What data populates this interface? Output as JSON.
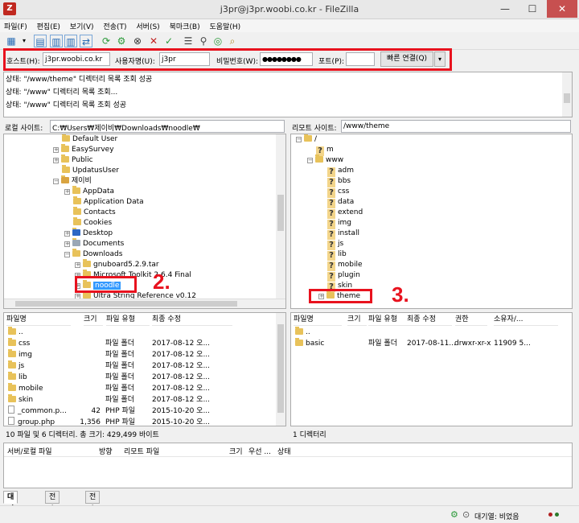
{
  "window": {
    "title": "j3pr@j3pr.woobi.co.kr - FileZilla",
    "app_icon": "Z",
    "minimize": "—",
    "maximize": "☐",
    "close": "✕"
  },
  "menu": [
    "파일(F)",
    "편집(E)",
    "보기(V)",
    "전송(T)",
    "서버(S)",
    "북마크(B)",
    "도움말(H)"
  ],
  "quickconnect": {
    "host_label": "호스트(H):",
    "host_value": "j3pr.woobi.co.kr",
    "user_label": "사용자명(U):",
    "user_value": "j3pr",
    "pass_label": "비밀번호(W):",
    "pass_value": "●●●●●●●●",
    "port_label": "포트(P):",
    "port_value": "",
    "connect_button": "빠른 연결(Q)",
    "dropdown": "▾"
  },
  "annotations": {
    "one": "1.",
    "two": "2.",
    "three": "3."
  },
  "log": [
    "상태:  \"/www/theme\" 디렉터리 목록 조회 성공",
    "상태:  \"/www\" 디렉터리 목록 조회...",
    "상태:  \"/www\" 디렉터리 목록 조회 성공"
  ],
  "local": {
    "label": "로컬 사이트:",
    "path": "C:₩Users₩제이비₩Downloads₩noodle₩",
    "tree": {
      "default_user": "Default User",
      "easysurvey": "EasySurvey",
      "public": "Public",
      "updatususer": "UpdatusUser",
      "jeibi": "제이비",
      "appdata": "AppData",
      "application_data": "Application Data",
      "contacts": "Contacts",
      "cookies": "Cookies",
      "desktop": "Desktop",
      "documents": "Documents",
      "downloads": "Downloads",
      "gnuboard": "gnuboard5.2.9.tar",
      "mstoolkit": "Microsoft Toolkit 2.6.4 Final",
      "noodle": "noodle",
      "ultrastring": "Ultra String Reference v0.12"
    },
    "columns": [
      "파일명",
      "크기",
      "파일 유형",
      "최종 수정"
    ],
    "files": [
      {
        "name": "..",
        "size": "",
        "type": "",
        "modified": ""
      },
      {
        "name": "css",
        "size": "",
        "type": "파일 폴더",
        "modified": "2017-08-12 오..."
      },
      {
        "name": "img",
        "size": "",
        "type": "파일 폴더",
        "modified": "2017-08-12 오..."
      },
      {
        "name": "js",
        "size": "",
        "type": "파일 폴더",
        "modified": "2017-08-12 오..."
      },
      {
        "name": "lib",
        "size": "",
        "type": "파일 폴더",
        "modified": "2017-08-12 오..."
      },
      {
        "name": "mobile",
        "size": "",
        "type": "파일 폴더",
        "modified": "2017-08-12 오..."
      },
      {
        "name": "skin",
        "size": "",
        "type": "파일 폴더",
        "modified": "2017-08-12 오..."
      },
      {
        "name": "_common.p...",
        "size": "42",
        "type": "PHP 파일",
        "modified": "2015-10-20 오..."
      },
      {
        "name": "group.php",
        "size": "1,356",
        "type": "PHP 파일",
        "modified": "2015-10-20 오..."
      }
    ],
    "status": "10 파일 및 6 디렉터리. 총 크기: 429,499 바이트"
  },
  "remote": {
    "label": "리모트 사이트:",
    "path": "/www/theme",
    "tree": {
      "root": "/",
      "m": "m",
      "www": "www",
      "adm": "adm",
      "bbs": "bbs",
      "css": "css",
      "data": "data",
      "extend": "extend",
      "img": "img",
      "install": "install",
      "js": "js",
      "lib": "lib",
      "mobile": "mobile",
      "plugin": "plugin",
      "skin": "skin",
      "theme": "theme"
    },
    "columns": [
      "파일명",
      "크기",
      "파일 유형",
      "최종 수정",
      "권한",
      "소유자/..."
    ],
    "files": [
      {
        "name": "..",
        "size": "",
        "type": "",
        "modified": "",
        "perm": "",
        "owner": ""
      },
      {
        "name": "basic",
        "size": "",
        "type": "파일 폴더",
        "modified": "2017-08-11...",
        "perm": "drwxr-xr-x",
        "owner": "11909 5..."
      }
    ],
    "status": "1 디렉터리"
  },
  "queue": {
    "columns": [
      "서버/로컬 파일",
      "방향",
      "리모트 파일",
      "크기",
      "우선 ...",
      "상태"
    ]
  },
  "tabs": [
    "대기 파일",
    "전송 실패",
    "전송 성공"
  ],
  "statusbar": {
    "queue": "대기열: 비었음"
  },
  "colors": {
    "highlight": "#e8121e",
    "selection": "#3399ff",
    "folder": "#e8c25a"
  }
}
